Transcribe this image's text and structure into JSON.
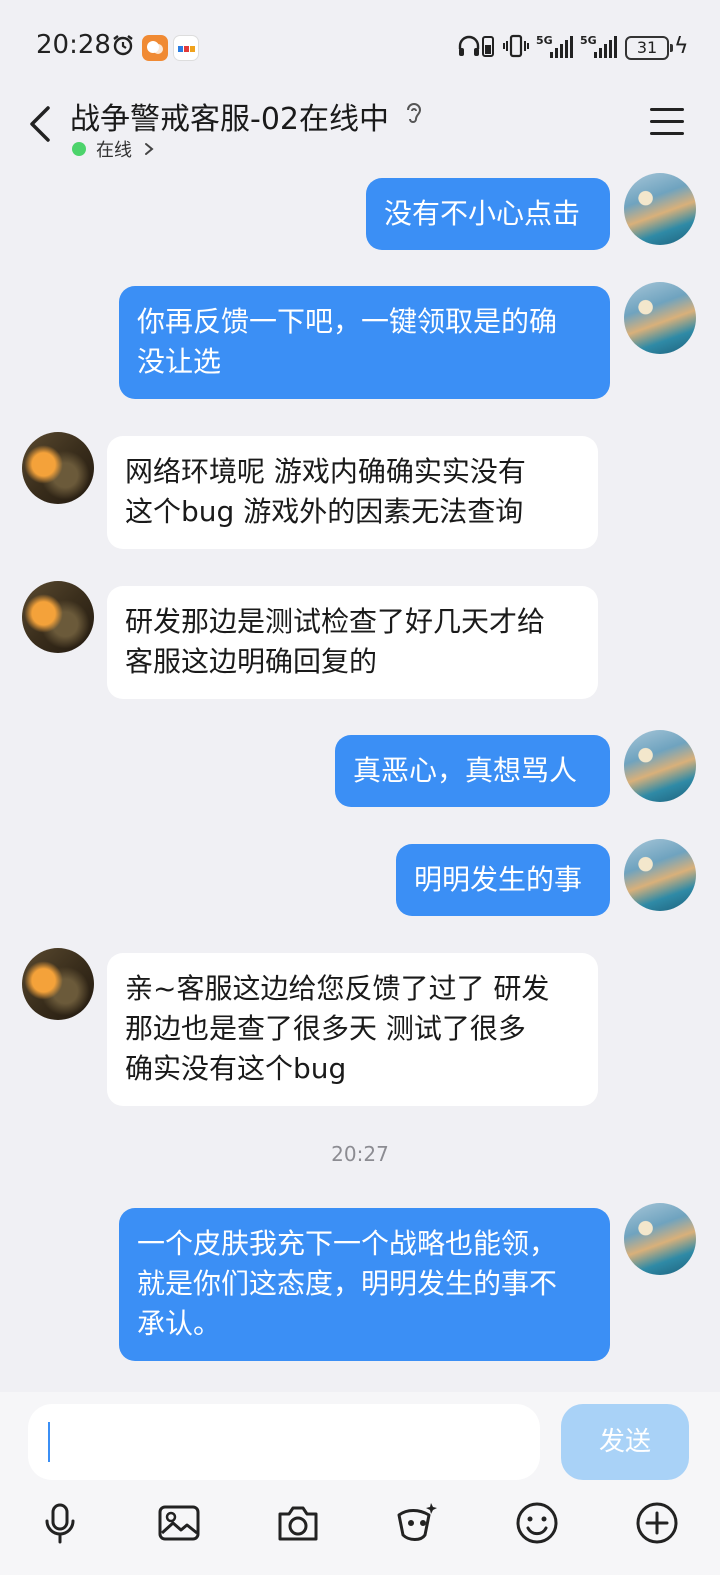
{
  "status_bar": {
    "time": "20:28",
    "network_1": "5G",
    "network_2": "5G",
    "battery": "31"
  },
  "header": {
    "title": "战争警戒客服-02在线中",
    "status": "在线"
  },
  "messages": [
    {
      "sender": "me",
      "text": "没有不小心点击"
    },
    {
      "sender": "me",
      "text": "你再反馈一下吧，一键领取是的确\n没让选"
    },
    {
      "sender": "cs",
      "text": "网络环境呢 游戏内确确实实没有\n这个bug 游戏外的因素无法查询"
    },
    {
      "sender": "cs",
      "text": "研发那边是测试检查了好几天才给\n客服这边明确回复的"
    },
    {
      "sender": "me",
      "text": "真恶心，真想骂人"
    },
    {
      "sender": "me",
      "text": "明明发生的事"
    },
    {
      "sender": "cs",
      "text": "亲~客服这边给您反馈了过了 研发\n那边也是查了很多天 测试了很多\n确实没有这个bug"
    },
    {
      "sender": "me",
      "text": "一个皮肤我充下一个战略也能领，\n就是你们这态度，明明发生的事不\n承认。"
    }
  ],
  "timestamp": "20:27",
  "input": {
    "value": "",
    "send_label": "发送"
  },
  "toolbar_icons": [
    "microphone-icon",
    "image-icon",
    "camera-icon",
    "sticker-icon",
    "emoji-icon",
    "plus-icon"
  ],
  "colors": {
    "my_bubble": "#3b8ff5",
    "other_bubble": "#ffffff",
    "send_button": "#a9d2f7",
    "online": "#4cd36b",
    "background": "#f0f0f4"
  }
}
